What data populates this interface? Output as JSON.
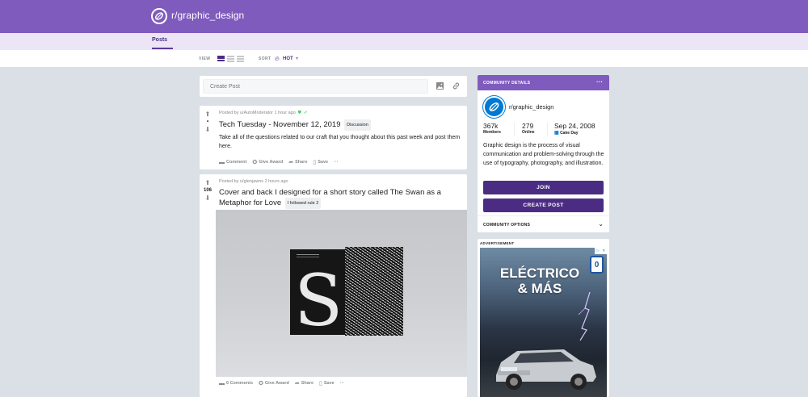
{
  "header": {
    "subreddit": "r/graphic_design"
  },
  "tabs": {
    "posts_label": "Posts"
  },
  "viewbar": {
    "view_label": "VIEW",
    "sort_label": "SORT",
    "sort_value": "HOT"
  },
  "create_post": {
    "placeholder": "Create Post"
  },
  "posts": [
    {
      "meta": "Posted by u/AutoModerator 1 hour ago",
      "score": "•",
      "title": "Tech Tuesday - November 12, 2019",
      "flair": "Discussion",
      "body": "Take all of the questions related to our craft that you thought about this past week and post them here.",
      "actions": {
        "comment": "Comment",
        "award": "Give Award",
        "share": "Share",
        "save": "Save",
        "more": "···"
      }
    },
    {
      "meta": "Posted by u/glenjawns 2 hours ago",
      "score": "106",
      "title": "Cover and back I designed for a short story called The Swan as a Metaphor for Love",
      "flair": "I followed rule 2",
      "actions": {
        "comment": "6 Comments",
        "award": "Give Award",
        "share": "Share",
        "save": "Save",
        "more": "···"
      }
    }
  ],
  "sidebar": {
    "title": "COMMUNITY DETAILS",
    "more": "···",
    "subreddit": "r/graphic_design",
    "members_value": "367k",
    "members_label": "Members",
    "online_value": "279",
    "online_label": "Online",
    "cake_value": "Sep 24, 2008",
    "cake_label": "Cake Day",
    "description": "Graphic design is the process of visual communication and problem-solving through the use of typography, photography, and illustration.",
    "join_label": "JOIN",
    "create_label": "CREATE POST",
    "options_label": "COMMUNITY OPTIONS"
  },
  "ad": {
    "label": "ADVERTISEMENT",
    "headline_1": "ELÉCTRICO",
    "headline_2": "& MÁS",
    "badge": "0"
  },
  "colors": {
    "brand": "#7f5bbd",
    "button": "#4a2d83",
    "tab_bar": "#ebe5f6",
    "background": "#dae0e6"
  }
}
